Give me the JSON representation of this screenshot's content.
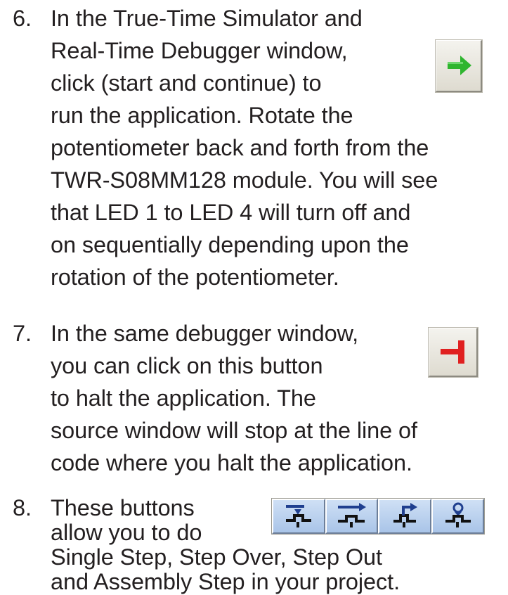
{
  "steps": [
    {
      "number": "6.",
      "lines": [
        "In the True-Time Simulator and",
        "Real-Time Debugger window,",
        "click (start and continue) to",
        "run the application. Rotate the",
        "potentiometer back and forth from the",
        "TWR-S08MM128 module. You will see",
        "that LED 1 to LED 4 will turn off and",
        "on sequentially depending upon the",
        "rotation of the potentiometer."
      ],
      "icon": "green-right-arrow-icon",
      "icon_color": "#2fb52f"
    },
    {
      "number": "7.",
      "lines": [
        "In the same debugger window,",
        "you can click on this button",
        "to halt the application. The",
        "source window will stop at the line of",
        "code where you halt the application."
      ],
      "icon": "red-halt-icon",
      "icon_color": "#e02020"
    },
    {
      "number": "8.",
      "lines": [
        "These buttons",
        "allow you to do",
        "Single Step, Step Over, Step Out",
        "and Assembly Step in your project."
      ],
      "icons": [
        "single-step-icon",
        "step-over-icon",
        "step-out-icon",
        "assembly-step-icon"
      ],
      "icon_color": "#1f3f8f"
    }
  ]
}
